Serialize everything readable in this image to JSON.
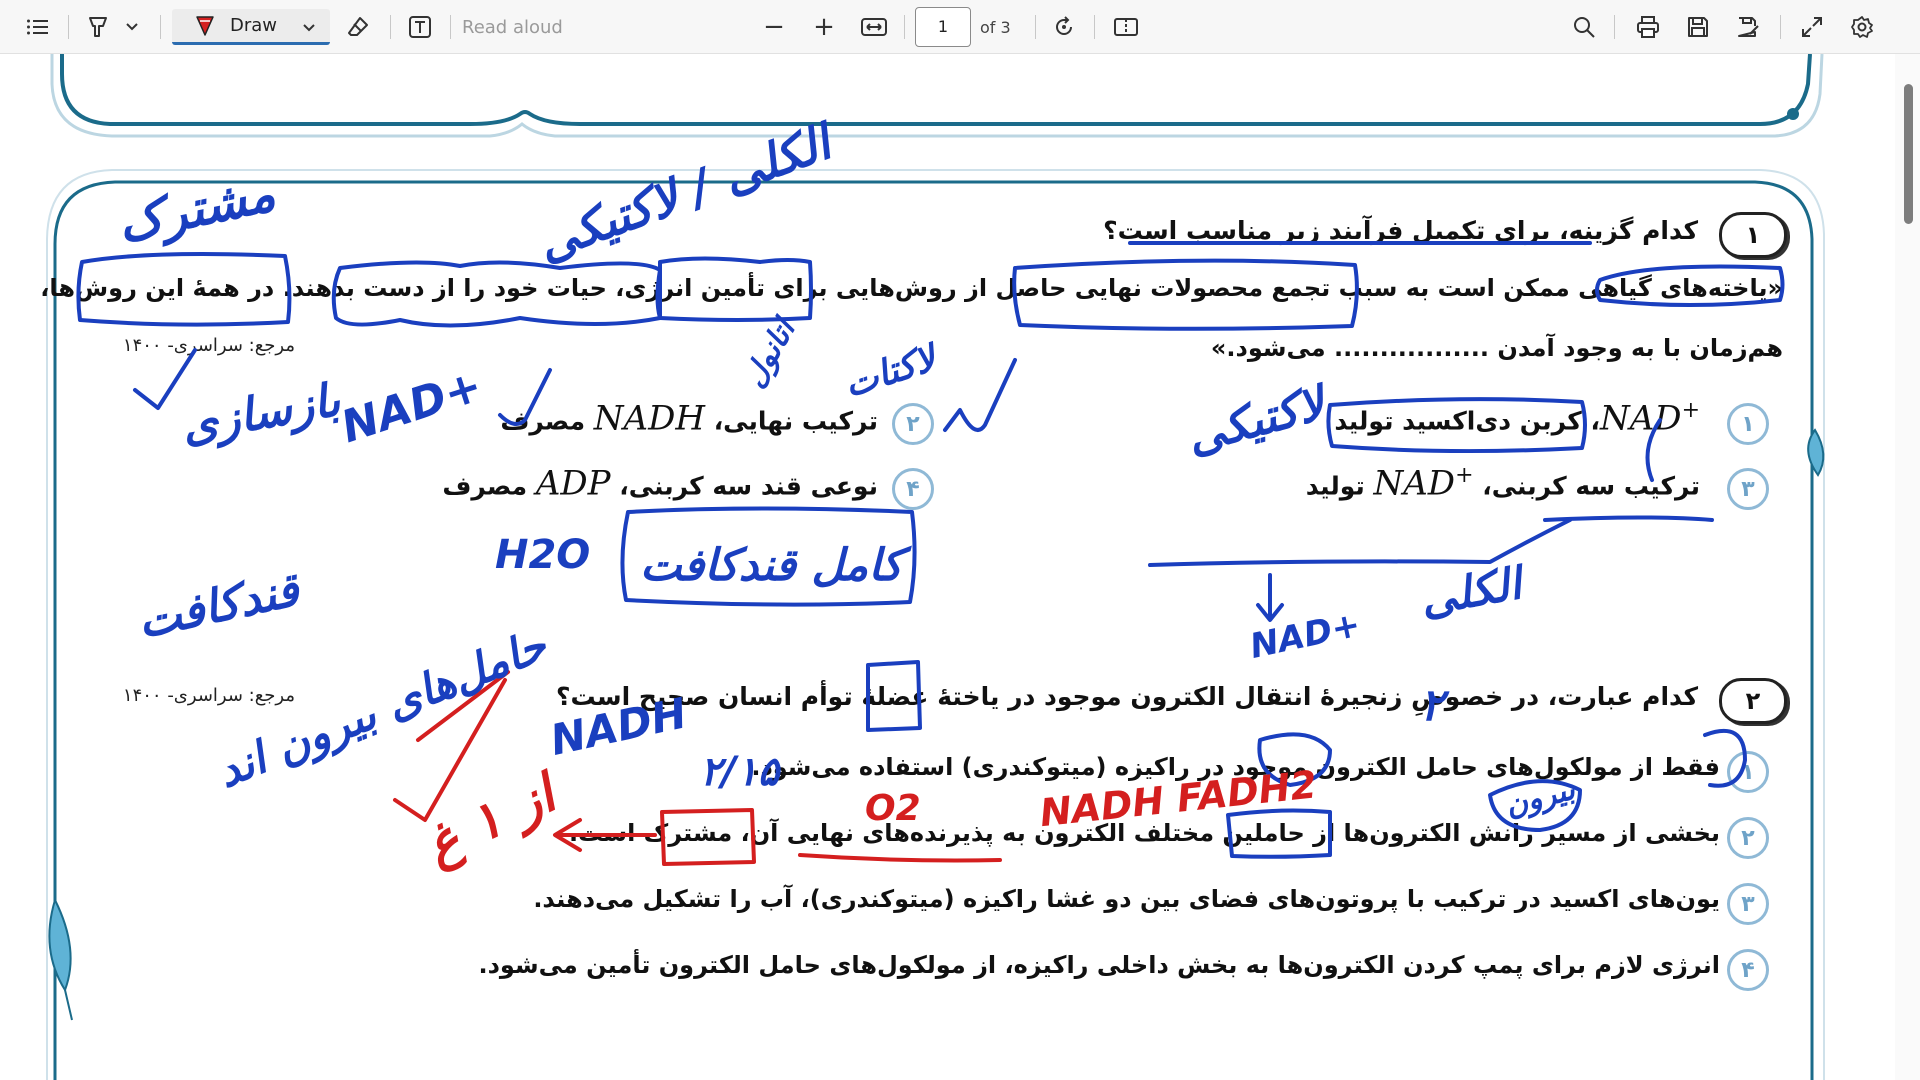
{
  "toolbar": {
    "contents_icon": "contents-list-icon",
    "highlight_icon": "highlighter-icon",
    "draw_label": "Draw",
    "eraser_icon": "eraser-icon",
    "text_icon": "text-box-icon",
    "read_aloud": "Read aloud",
    "zoom_out": "−",
    "zoom_in": "+",
    "page_current": "1",
    "page_total": "of 3",
    "accent": "#2b6cb0"
  },
  "q1": {
    "number": "۱",
    "stem": "کدام گزینه، برای تکمیل فرآیند زیر مناسب است؟",
    "line1": "«یاخته‌های گیاهی ممکن است به سبب تجمع محصولات نهایی حاصل از روش‌هایی برای تأمین انرژی، حیات خود را از دست بدهند. در همهٔ این روش‌ها،",
    "line2": "هم‌زمان با به وجود آمدن ................. می‌شود.»",
    "ref": "مرجع: سراسری- ۱۴۰۰",
    "options": [
      {
        "num": "۱",
        "pre": "",
        "math": "NAD",
        "sup": "+",
        "post": "، کربن دی‌اکسید تولید"
      },
      {
        "num": "۲",
        "pre": "ترکیب نهایی، ",
        "math": "NADH",
        "sup": "",
        "post": " مصرف"
      },
      {
        "num": "۳",
        "pre": "ترکیب سه کربنی، ",
        "math": "NAD",
        "sup": "+",
        "post": " تولید"
      },
      {
        "num": "۴",
        "pre": "نوعی قند سه کربنی، ",
        "math": "ADP",
        "sup": "",
        "post": " مصرف"
      }
    ]
  },
  "q2": {
    "number": "۲",
    "stem": "کدام عبارت، در خصوصِ زنجیرهٔ انتقال الکترون موجود در یاختهٔ عضلهٔ توأم انسان صحیح است؟",
    "ref": "مرجع: سراسری- ۱۴۰۰",
    "options": [
      {
        "num": "۱",
        "text": "فقط از مولکول‌های حامل الکترون موجود در راکیزه (میتوکندری) استفاده می‌شود."
      },
      {
        "num": "۲",
        "text": "بخشی از مسیر رانش الکترون‌ها از حاملین مختلف الکترون به پذیرنده‌های نهایی آن، مشترک است."
      },
      {
        "num": "۳",
        "text": "یون‌های اکسید در ترکیب با پروتون‌های فضای بین دو غشا راکیزه (میتوکندری)، آب را تشکیل می‌دهند."
      },
      {
        "num": "۴",
        "text": "انرژی لازم برای پمپ کردن الکترون‌ها به بخش داخلی راکیزه، از مولکول‌های حامل الکترون تأمین می‌شود."
      }
    ]
  },
  "ink": {
    "blue_color": "#1a3fbf",
    "red_color": "#d41f1f",
    "notes_blue": [
      "مشترک",
      "الکلی / لاکتیکی",
      "اتانول",
      "لاکتات",
      "بازسازی",
      "NAD+",
      "قندکافت",
      "H2O",
      "کامل قندکافت",
      "لاکتیکی",
      "الکلی",
      "NAD+",
      "حامل‌های بیرون اند",
      "NADH",
      "۲/۱۵",
      "۲",
      "بیرون"
    ],
    "notes_red": [
      "NADH FADH2",
      "O2",
      "از ۱ غ"
    ]
  }
}
